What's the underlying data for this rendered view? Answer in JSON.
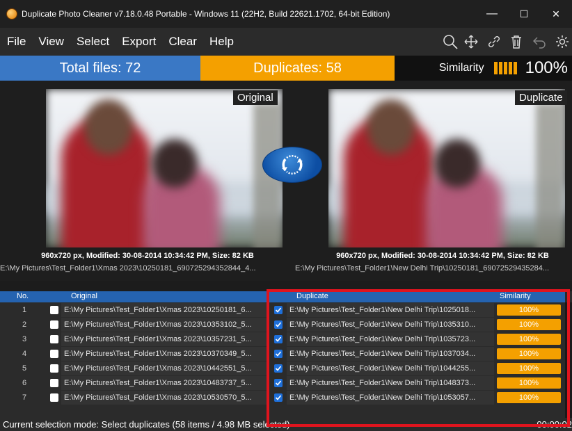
{
  "window": {
    "title": "Duplicate Photo Cleaner v7.18.0.48 Portable - Windows 11 (22H2, Build 22621.1702, 64-bit Edition)",
    "minimize_glyph": "—",
    "maximize_glyph": "☐",
    "close_glyph": "✕"
  },
  "menu": [
    "File",
    "View",
    "Select",
    "Export",
    "Clear",
    "Help"
  ],
  "toolbar_icons": [
    "search-icon",
    "move-icon",
    "link-icon",
    "trash-icon",
    "undo-icon",
    "gear-icon"
  ],
  "stats": {
    "total": "Total files: 72",
    "duplicates": "Duplicates: 58",
    "similarity_label": "Similarity",
    "similarity_value": "100%"
  },
  "preview": {
    "left_tag": "Original",
    "right_tag": "Duplicate",
    "left_info": "960x720 px, Modified: 30-08-2014 10:34:42 PM, Size: 82 KB",
    "right_info": "960x720 px, Modified: 30-08-2014 10:34:42 PM, Size: 82 KB",
    "left_path": "E:\\My Pictures\\Test_Folder1\\Xmas 2023\\10250181_690725294352844_4...",
    "right_path": "E:\\My Pictures\\Test_Folder1\\New Delhi Trip\\10250181_69072529435284..."
  },
  "table": {
    "headers": {
      "no": "No.",
      "original": "Original",
      "duplicate": "Duplicate",
      "similarity": "Similarity"
    },
    "rows": [
      {
        "no": "1",
        "original": "E:\\My Pictures\\Test_Folder1\\Xmas 2023\\10250181_6...",
        "duplicate": "E:\\My Pictures\\Test_Folder1\\New Delhi Trip\\1025018...",
        "similarity": "100%"
      },
      {
        "no": "2",
        "original": "E:\\My Pictures\\Test_Folder1\\Xmas 2023\\10353102_5...",
        "duplicate": "E:\\My Pictures\\Test_Folder1\\New Delhi Trip\\1035310...",
        "similarity": "100%"
      },
      {
        "no": "3",
        "original": "E:\\My Pictures\\Test_Folder1\\Xmas 2023\\10357231_5...",
        "duplicate": "E:\\My Pictures\\Test_Folder1\\New Delhi Trip\\1035723...",
        "similarity": "100%"
      },
      {
        "no": "4",
        "original": "E:\\My Pictures\\Test_Folder1\\Xmas 2023\\10370349_5...",
        "duplicate": "E:\\My Pictures\\Test_Folder1\\New Delhi Trip\\1037034...",
        "similarity": "100%"
      },
      {
        "no": "5",
        "original": "E:\\My Pictures\\Test_Folder1\\Xmas 2023\\10442551_5...",
        "duplicate": "E:\\My Pictures\\Test_Folder1\\New Delhi Trip\\1044255...",
        "similarity": "100%"
      },
      {
        "no": "6",
        "original": "E:\\My Pictures\\Test_Folder1\\Xmas 2023\\10483737_5...",
        "duplicate": "E:\\My Pictures\\Test_Folder1\\New Delhi Trip\\1048373...",
        "similarity": "100%"
      },
      {
        "no": "7",
        "original": "E:\\My Pictures\\Test_Folder1\\Xmas 2023\\10530570_5...",
        "duplicate": "E:\\My Pictures\\Test_Folder1\\New Delhi Trip\\1053057...",
        "similarity": "100%"
      }
    ]
  },
  "status": {
    "message": "Current selection mode: Select duplicates (58 items / 4.98 MB selected)",
    "time": "00:00:02"
  },
  "colors": {
    "total_bg": "#3a78c5",
    "duplicates_bg": "#f4a000",
    "highlight": "#e0141e"
  }
}
